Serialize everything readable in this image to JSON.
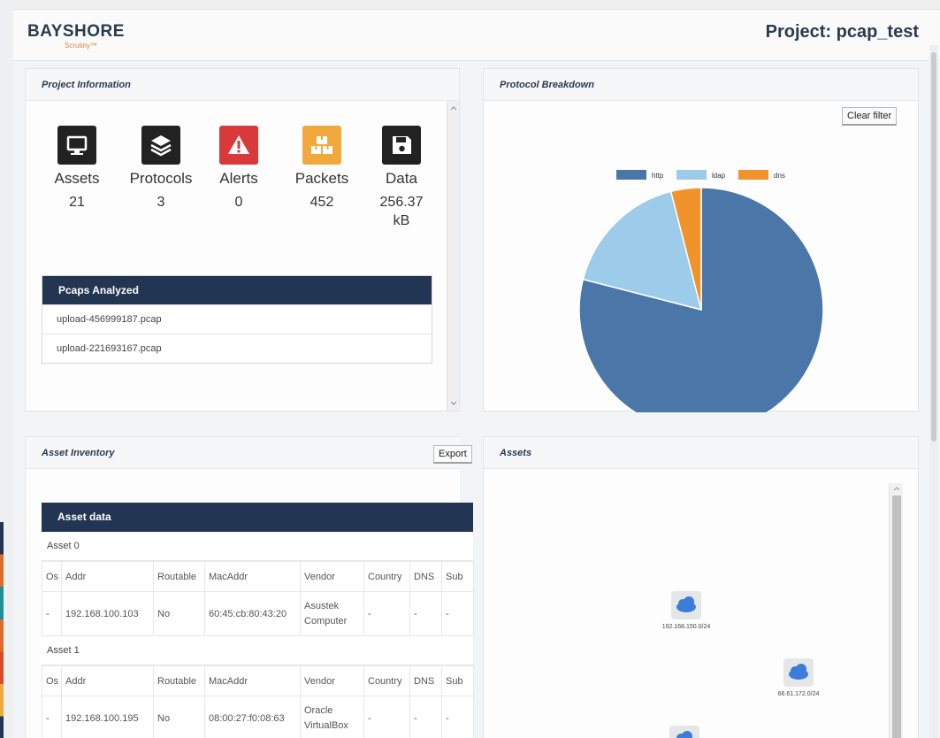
{
  "brand": {
    "name": "BAYSHORE",
    "sub": "Scrutiny™"
  },
  "project_title": "Project: pcap_test",
  "project_info": {
    "title": "Project Information",
    "stats": [
      {
        "label": "Assets",
        "value": "21",
        "icon": "monitor-icon",
        "color": "#222222"
      },
      {
        "label": "Protocols",
        "value": "3",
        "icon": "layers-icon",
        "color": "#222222"
      },
      {
        "label": "Alerts",
        "value": "0",
        "icon": "warning-icon",
        "color": "#d9393a"
      },
      {
        "label": "Packets",
        "value": "452",
        "icon": "packages-icon",
        "color": "#f2a93b"
      },
      {
        "label": "Data",
        "value": "256.37 kB",
        "icon": "floppy-disk-icon",
        "color": "#222222"
      }
    ],
    "pcaps_header": "Pcaps Analyzed",
    "pcaps": [
      "upload-456999187.pcap",
      "upload-221693167.pcap"
    ]
  },
  "protocol_breakdown": {
    "title": "Protocol Breakdown",
    "clear_filter": "Clear filter"
  },
  "chart_data": {
    "type": "pie",
    "categories": [
      "http",
      "ldap",
      "dns"
    ],
    "values": [
      79,
      17,
      4
    ],
    "colors": [
      "#4a76a8",
      "#9dcbea",
      "#f2922b"
    ],
    "legend": "top"
  },
  "asset_inventory": {
    "title": "Asset Inventory",
    "export": "Export",
    "table_header": "Asset data",
    "columns": [
      "Os",
      "Addr",
      "Routable",
      "MacAddr",
      "Vendor",
      "Country",
      "DNS",
      "Sub"
    ],
    "assets": [
      {
        "title": "Asset 0",
        "row": [
          "-",
          "192.168.100.103",
          "No",
          "60:45:cb:80:43:20",
          "Asustek Computer",
          "-",
          "-",
          "-"
        ]
      },
      {
        "title": "Asset 1",
        "row": [
          "-",
          "192.168.100.195",
          "No",
          "08:00:27:f0:08:63",
          "Oracle VirtualBox",
          "-",
          "-",
          "-"
        ]
      }
    ]
  },
  "assets_panel": {
    "title": "Assets",
    "nodes": [
      "192.168.150.0/24",
      "66.61.172.0/24"
    ]
  }
}
